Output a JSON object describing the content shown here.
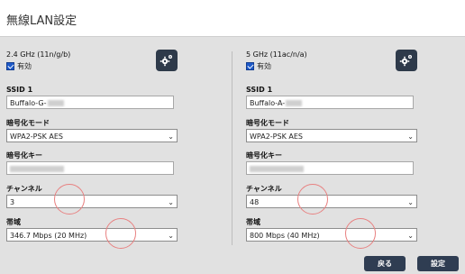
{
  "header": {
    "title": "無線LAN設定"
  },
  "left": {
    "band": "2.4 GHz (11n/g/b)",
    "enabled_label": "有効",
    "ssid_label": "SSID 1",
    "ssid_value": "Buffalo-G-",
    "enc_mode_label": "暗号化モード",
    "enc_mode_value": "WPA2-PSK AES",
    "enc_key_label": "暗号化キー",
    "channel_label": "チャンネル",
    "channel_value": "3",
    "bandwidth_label": "帯域",
    "bandwidth_value": "346.7 Mbps (20 MHz)"
  },
  "right": {
    "band": "5 GHz (11ac/n/a)",
    "enabled_label": "有効",
    "ssid_label": "SSID 1",
    "ssid_value": "Buffalo-A-",
    "enc_mode_label": "暗号化モード",
    "enc_mode_value": "WPA2-PSK AES",
    "enc_key_label": "暗号化キー",
    "channel_label": "チャンネル",
    "channel_value": "48",
    "bandwidth_label": "帯域",
    "bandwidth_value": "800 Mbps (40 MHz)"
  },
  "footer": {
    "back_label": "戻る",
    "apply_label": "設定"
  },
  "icons": {
    "gear": "gear-icon",
    "chevron": "chevron-down-icon"
  },
  "colors": {
    "button_bg": "#2f3d52",
    "checkbox": "#1d59c9",
    "annotation": "#e88080"
  }
}
